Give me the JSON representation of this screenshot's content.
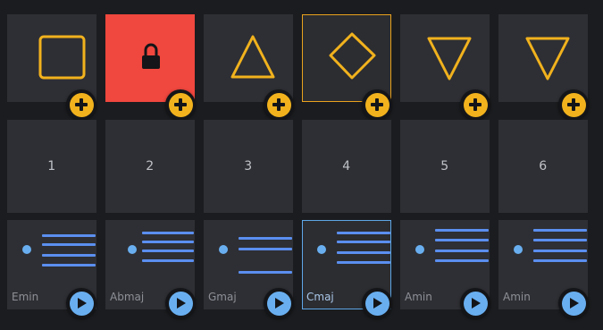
{
  "colors": {
    "accent": "#f1b21d",
    "locked": "#f0473e",
    "play": "#69aff0",
    "lines": "#5b8ff0",
    "cell_bg": "#2e2f34"
  },
  "steps": [
    {
      "shape": "square-icon",
      "locked": false,
      "selected": false,
      "number": "1",
      "chord": "Emin"
    },
    {
      "shape": "lock-icon",
      "locked": true,
      "selected": false,
      "number": "2",
      "chord": "Abmaj"
    },
    {
      "shape": "triangle-up-icon",
      "locked": false,
      "selected": false,
      "number": "3",
      "chord": "Gmaj"
    },
    {
      "shape": "diamond-icon",
      "locked": false,
      "selected": true,
      "number": "4",
      "chord": "Cmaj"
    },
    {
      "shape": "triangle-down-icon",
      "locked": false,
      "selected": false,
      "number": "5",
      "chord": "Amin"
    },
    {
      "shape": "triangle-down-icon",
      "locked": false,
      "selected": false,
      "number": "6",
      "chord": "Amin"
    }
  ]
}
